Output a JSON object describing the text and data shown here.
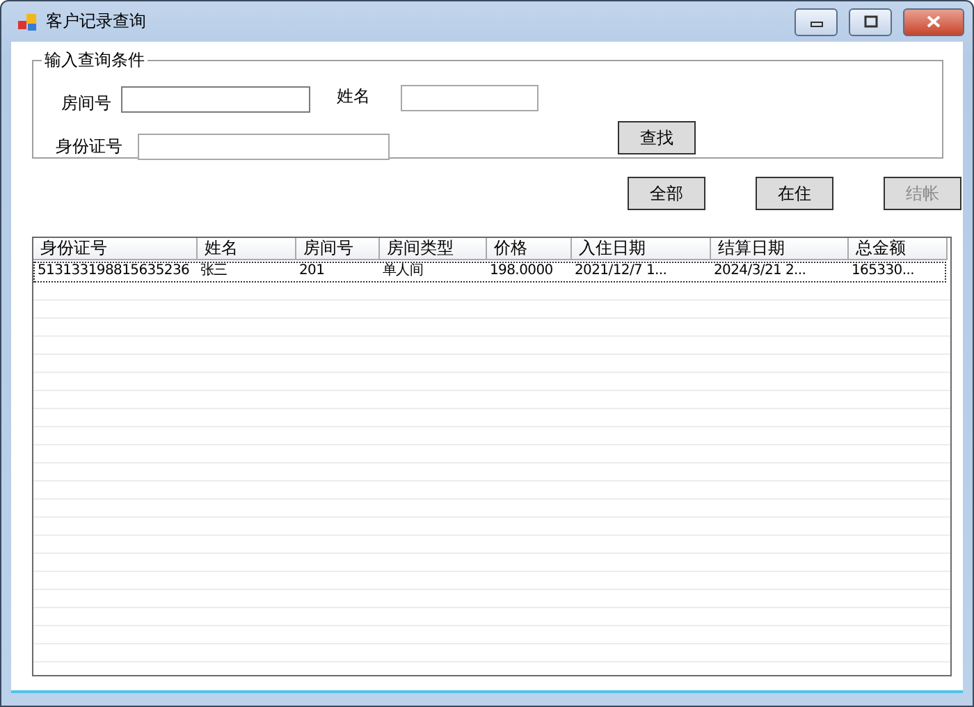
{
  "window": {
    "title": "客户记录查询"
  },
  "query_group": {
    "title": "输入查询条件",
    "room_label": "房间号",
    "name_label": "姓名",
    "id_label": "身份证号",
    "search_button": "查找"
  },
  "buttons": [
    {
      "label": "全部",
      "disabled": false
    },
    {
      "label": "在住",
      "disabled": false
    },
    {
      "label": "结帐",
      "disabled": true
    }
  ],
  "table": {
    "columns": [
      "身份证号",
      "姓名",
      "房间号",
      "房间类型",
      "价格",
      "入住日期",
      "结算日期",
      "总金额"
    ],
    "rows": [
      [
        "513133198815635236",
        "张三",
        "201",
        "单人间",
        "198.0000",
        "2021/12/7 1...",
        "2024/3/21 2...",
        "165330..."
      ]
    ]
  }
}
